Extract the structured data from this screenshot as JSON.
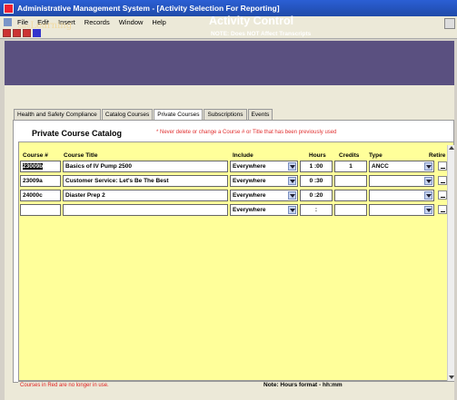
{
  "window": {
    "title": "Administrative Management System - [Activity Selection For Reporting]"
  },
  "menu": {
    "items": [
      "File",
      "Edit",
      "Insert",
      "Records",
      "Window",
      "Help"
    ]
  },
  "header": {
    "logo": "Learning",
    "logo_prefix": "care",
    "title": "Activity Control",
    "subtitle": "NOTE: Does NOT Affect Transcripts"
  },
  "tabs": [
    "Health and Safety Compliance",
    "Catalog Courses",
    "Private Courses",
    "Subscriptions",
    "Events"
  ],
  "active_tab": "Private Courses",
  "catalog": {
    "title": "Private Course Catalog",
    "note": "* Never delete or change a Course # or Title that has been previously used",
    "columns": {
      "course_no": "Course #",
      "course_title": "Course Title",
      "include": "Include",
      "hours": "Hours",
      "credits": "Credits",
      "type": "Type",
      "retire": "Retire"
    },
    "rows": [
      {
        "course_no": "23009b",
        "title": "Basics of IV Pump 2500",
        "include": "Everywhere",
        "hours": "1 :00",
        "credits": "1",
        "type": "ANCC"
      },
      {
        "course_no": "23009a",
        "title": "Customer Service: Let's Be The Best",
        "include": "Everywhere",
        "hours": "0 :30",
        "credits": "",
        "type": ""
      },
      {
        "course_no": "24000c",
        "title": "Diaster Prep 2",
        "include": "Everywhere",
        "hours": "0 :20",
        "credits": "",
        "type": ""
      },
      {
        "course_no": "",
        "title": "",
        "include": "Everywhere",
        "hours": ":",
        "credits": "",
        "type": ""
      }
    ]
  },
  "footer": {
    "left": "Courses in Red are no longer in use.",
    "right": "Note: Hours format - hh:mm"
  },
  "colors": {
    "header_bg": "#5a5080",
    "grid_bg": "#ffff9a",
    "note_red": "#e03030",
    "titlebar": "#2b5fd4"
  }
}
